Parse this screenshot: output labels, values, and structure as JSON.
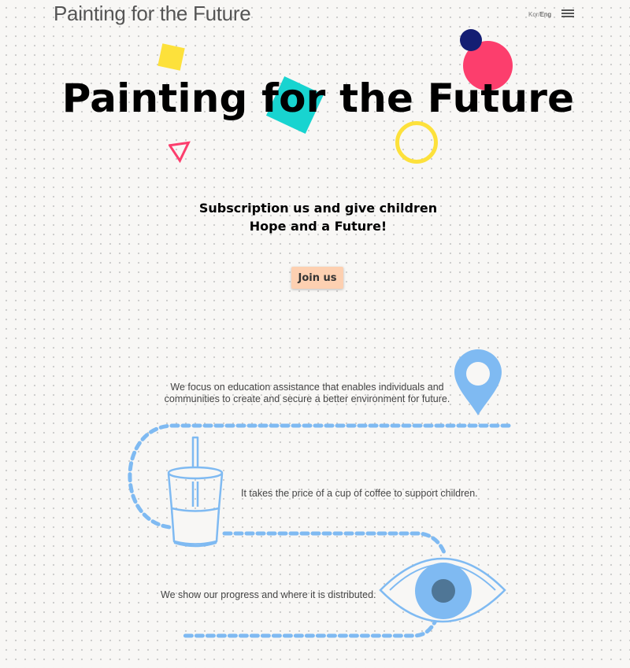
{
  "header": {
    "logo_text": "Painting for the Future",
    "lang_kor": "Kor",
    "lang_sep": "/",
    "lang_eng": "Eng",
    "menu_icon": "hamburger-menu-icon"
  },
  "hero": {
    "title": "Painting for the Future",
    "subtitle_line1": "Subscription us and give children",
    "subtitle_line2": "Hope and a Future!",
    "cta_label": "Join us",
    "cta_color": "#fdd0b1"
  },
  "features": [
    {
      "text": "We focus on education assistance that enables individuals and communities to create and secure a better environment for future.",
      "icon": "location-pin-icon"
    },
    {
      "text": "It takes the price of a cup of coffee to support children.",
      "icon": "cup-with-straw-icon"
    },
    {
      "text": "We show our progress and where it is distributed.",
      "icon": "eye-icon"
    }
  ],
  "colors": {
    "yellow": "#fde13b",
    "teal": "#18d4d0",
    "pink": "#fc3e6d",
    "navy": "#141e73",
    "path_blue": "#7fbaf2"
  }
}
